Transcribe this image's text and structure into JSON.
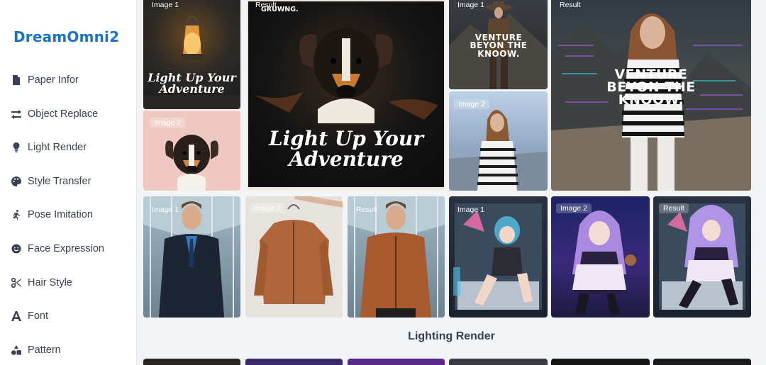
{
  "app": {
    "title": "DreamOmni2"
  },
  "sidebar": {
    "items": [
      {
        "label": "Paper Infor",
        "icon": "document-icon"
      },
      {
        "label": "Object Replace",
        "icon": "swap-arrows-icon"
      },
      {
        "label": "Light Render",
        "icon": "lightbulb-icon"
      },
      {
        "label": "Style Transfer",
        "icon": "palette-icon"
      },
      {
        "label": "Pose Imitation",
        "icon": "running-person-icon"
      },
      {
        "label": "Face Expression",
        "icon": "smile-icon"
      },
      {
        "label": "Hair Style",
        "icon": "scissors-icon"
      },
      {
        "label": "Font",
        "icon": "letter-a-icon"
      },
      {
        "label": "Pattern",
        "icon": "shapes-icon"
      }
    ]
  },
  "gallery": {
    "row1": {
      "lantern": {
        "tag": "Image 1",
        "caption": "Light Up Your Adventure"
      },
      "dog": {
        "tag": "Image 2"
      },
      "result_dog": {
        "tag": "Result",
        "brand": "GRUWNG.",
        "caption": "Light Up Your Adventure"
      },
      "explorer": {
        "tag": "Image 1",
        "caption": "VENTURE BEYON THE KNOOW."
      },
      "woman": {
        "tag": "Image 2"
      },
      "result_woman": {
        "tag": "Result",
        "caption": "VENTURE BEYON THE KNOOW."
      }
    },
    "row2": {
      "suit": {
        "tag": "Image 1"
      },
      "jacket": {
        "tag": "Image 2"
      },
      "result_man": {
        "tag": "Result"
      },
      "anime1": {
        "tag": "Image 1"
      },
      "anime2": {
        "tag": "Image 2"
      },
      "result_anime": {
        "tag": "Result"
      }
    }
  },
  "section": {
    "title": "Lighting Render"
  },
  "colors": {
    "brand": "#1a73c8",
    "text": "#374151",
    "background": "#f3f4f6"
  }
}
